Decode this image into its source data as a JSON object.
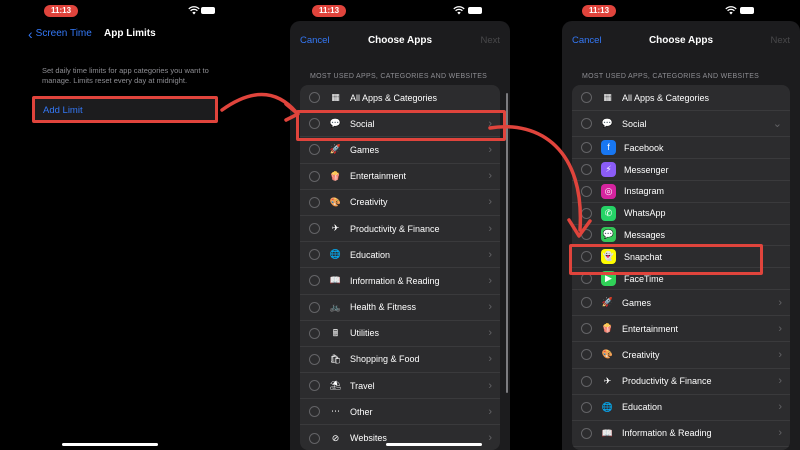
{
  "status_bar": {
    "time": "11:13"
  },
  "colors": {
    "accent": "#3478f6",
    "highlight": "#e0443c",
    "sheet": "#1c1c1e",
    "list": "#2c2c2e"
  },
  "panel1": {
    "back_label": "Screen Time",
    "title": "App Limits",
    "description": "Set daily time limits for app categories you want to manage. Limits reset every day at midnight.",
    "add_limit": "Add Limit"
  },
  "sheet": {
    "cancel": "Cancel",
    "title": "Choose Apps",
    "next": "Next",
    "section_header": "MOST USED APPS, CATEGORIES AND WEBSITES"
  },
  "panel2_rows": [
    {
      "label": "All Apps & Categories",
      "icon": "stack-icon",
      "glyph": "▦",
      "chevron": false
    },
    {
      "label": "Social",
      "icon": "chat-bubbles-icon",
      "glyph": "💬",
      "chevron": true
    },
    {
      "label": "Games",
      "icon": "rocket-icon",
      "glyph": "🚀",
      "chevron": true
    },
    {
      "label": "Entertainment",
      "icon": "popcorn-icon",
      "glyph": "🍿",
      "chevron": true
    },
    {
      "label": "Creativity",
      "icon": "palette-icon",
      "glyph": "🎨",
      "chevron": true
    },
    {
      "label": "Productivity & Finance",
      "icon": "paper-plane-icon",
      "glyph": "✈",
      "chevron": true
    },
    {
      "label": "Education",
      "icon": "globe-icon",
      "glyph": "🌐",
      "chevron": true
    },
    {
      "label": "Information & Reading",
      "icon": "book-icon",
      "glyph": "📖",
      "chevron": true
    },
    {
      "label": "Health & Fitness",
      "icon": "bike-icon",
      "glyph": "🚲",
      "chevron": true
    },
    {
      "label": "Utilities",
      "icon": "calculator-icon",
      "glyph": "🖩",
      "chevron": true
    },
    {
      "label": "Shopping & Food",
      "icon": "shopping-bags-icon",
      "glyph": "🛍",
      "chevron": true
    },
    {
      "label": "Travel",
      "icon": "beach-umbrella-icon",
      "glyph": "⛱",
      "chevron": true
    },
    {
      "label": "Other",
      "icon": "ellipsis-icon",
      "glyph": "⋯",
      "chevron": true
    },
    {
      "label": "Websites",
      "icon": "compass-icon",
      "glyph": "⊘",
      "chevron": true
    }
  ],
  "panel3_rows": [
    {
      "label": "All Apps & Categories",
      "icon": "stack-icon",
      "glyph": "▦",
      "type": "cat",
      "chevron": ""
    },
    {
      "label": "Social",
      "icon": "chat-bubbles-icon",
      "glyph": "💬",
      "type": "cat",
      "chevron": "⌄"
    },
    {
      "label": "Facebook",
      "icon": "facebook-icon",
      "glyph": "f",
      "type": "child",
      "bg": "#1877f2"
    },
    {
      "label": "Messenger",
      "icon": "messenger-icon",
      "glyph": "⚡",
      "type": "child",
      "bg": "#8b5cf6"
    },
    {
      "label": "Instagram",
      "icon": "instagram-icon",
      "glyph": "◎",
      "type": "child",
      "bg": "#d6249f"
    },
    {
      "label": "WhatsApp",
      "icon": "whatsapp-icon",
      "glyph": "✆",
      "type": "child",
      "bg": "#25d366"
    },
    {
      "label": "Messages",
      "icon": "messages-icon",
      "glyph": "💬",
      "type": "child",
      "bg": "#34c759"
    },
    {
      "label": "Snapchat",
      "icon": "snapchat-icon",
      "glyph": "👻",
      "type": "child",
      "bg": "#fffc00"
    },
    {
      "label": "FaceTime",
      "icon": "facetime-icon",
      "glyph": "▶",
      "type": "child",
      "bg": "#30d158"
    },
    {
      "label": "Games",
      "icon": "rocket-icon",
      "glyph": "🚀",
      "type": "cat",
      "chevron": "›"
    },
    {
      "label": "Entertainment",
      "icon": "popcorn-icon",
      "glyph": "🍿",
      "type": "cat",
      "chevron": "›"
    },
    {
      "label": "Creativity",
      "icon": "palette-icon",
      "glyph": "🎨",
      "type": "cat",
      "chevron": "›"
    },
    {
      "label": "Productivity & Finance",
      "icon": "paper-plane-icon",
      "glyph": "✈",
      "type": "cat",
      "chevron": "›"
    },
    {
      "label": "Education",
      "icon": "globe-icon",
      "glyph": "🌐",
      "type": "cat",
      "chevron": "›"
    },
    {
      "label": "Information & Reading",
      "icon": "book-icon",
      "glyph": "📖",
      "type": "cat",
      "chevron": "›"
    }
  ]
}
